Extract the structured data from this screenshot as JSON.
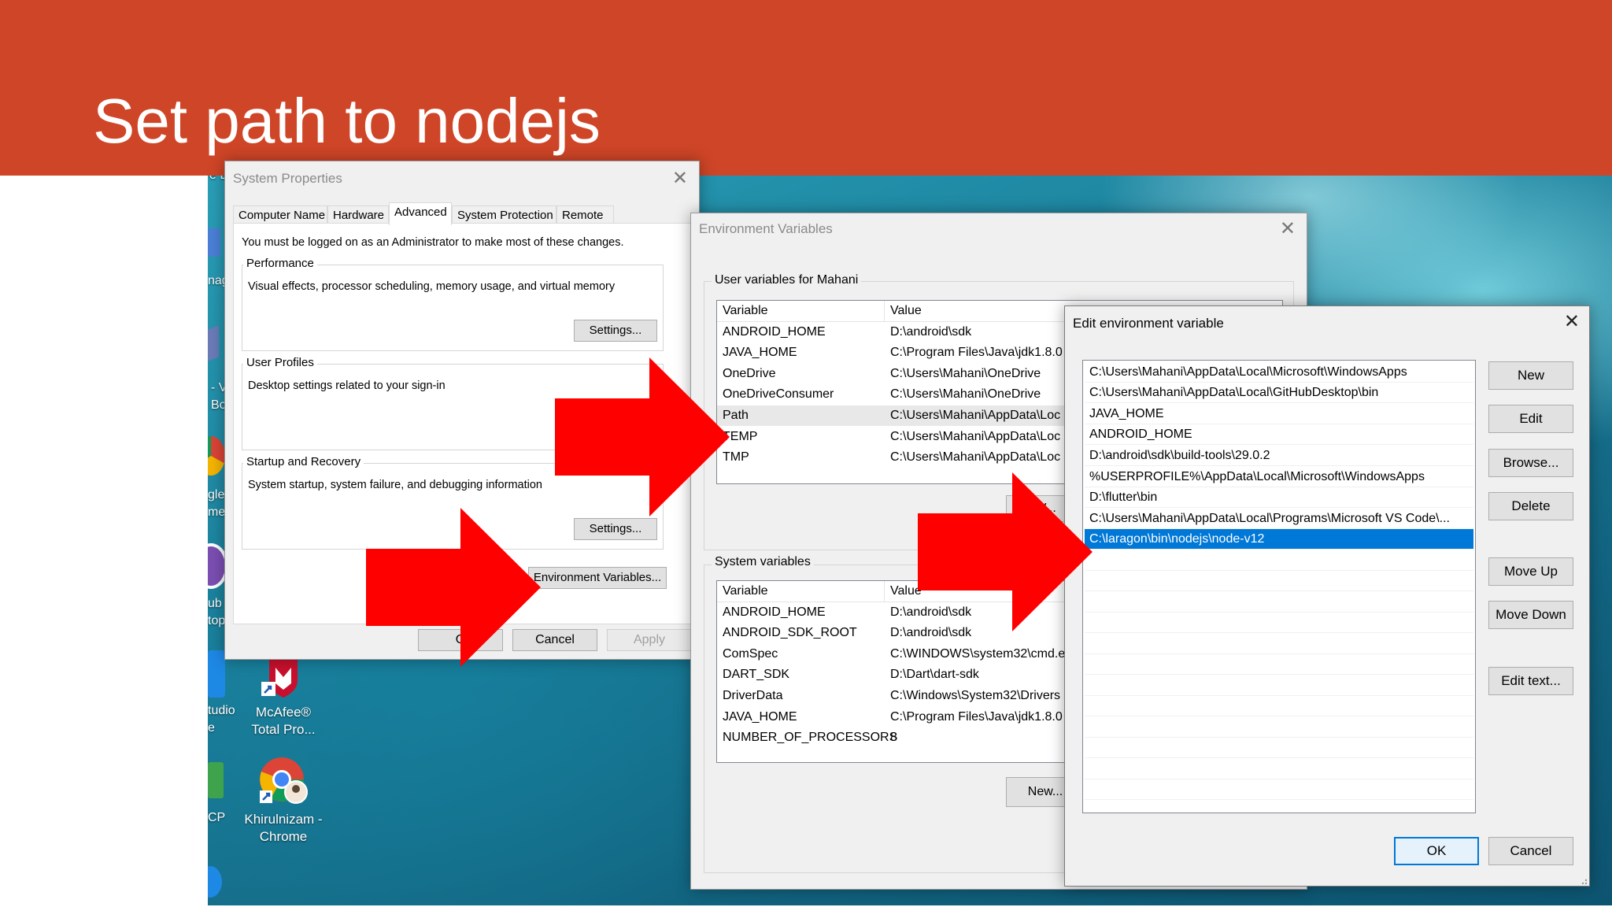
{
  "slide": {
    "title": "Set path to nodejs"
  },
  "desktop": {
    "icons": [
      {
        "label_line1": "McAfee®",
        "label_line2": "Total Pro...",
        "icon": "mcafee-shield-icon"
      },
      {
        "label_line1": "Khirulnizam -",
        "label_line2": "Chrome",
        "icon": "chrome-user-icon"
      }
    ],
    "edge_fragments": [
      "e B",
      "nag",
      "- VI",
      "Bo",
      "gle",
      "me",
      "ub",
      "top",
      "tudio",
      "e",
      "CP"
    ]
  },
  "system_properties": {
    "title": "System Properties",
    "tabs": [
      "Computer Name",
      "Hardware",
      "Advanced",
      "System Protection",
      "Remote"
    ],
    "active_tab": "Advanced",
    "admin_note": "You must be logged on as an Administrator to make most of these changes.",
    "performance": {
      "label": "Performance",
      "desc": "Visual effects, processor scheduling, memory usage, and virtual memory",
      "button": "Settings..."
    },
    "user_profiles": {
      "label": "User Profiles",
      "desc": "Desktop settings related to your sign-in"
    },
    "startup": {
      "label": "Startup and Recovery",
      "desc": "System startup, system failure, and debugging information",
      "button": "Settings..."
    },
    "env_button": "Environment Variables...",
    "ok": "O",
    "cancel": "Cancel",
    "apply": "Apply"
  },
  "env_vars": {
    "title": "Environment Variables",
    "user_label": "User variables for Mahani",
    "col_variable": "Variable",
    "col_value": "Value",
    "user_rows": [
      {
        "name": "ANDROID_HOME",
        "value": "D:\\android\\sdk"
      },
      {
        "name": "JAVA_HOME",
        "value": "C:\\Program Files\\Java\\jdk1.8.0"
      },
      {
        "name": "OneDrive",
        "value": "C:\\Users\\Mahani\\OneDrive"
      },
      {
        "name": "OneDriveConsumer",
        "value": "C:\\Users\\Mahani\\OneDrive"
      },
      {
        "name": "Path",
        "value": "C:\\Users\\Mahani\\AppData\\Loc"
      },
      {
        "name": "TEMP",
        "value": "C:\\Users\\Mahani\\AppData\\Loc"
      },
      {
        "name": "TMP",
        "value": "C:\\Users\\Mahani\\AppData\\Loc"
      }
    ],
    "user_new_button": "W...",
    "system_label": "System variables",
    "system_rows": [
      {
        "name": "ANDROID_HOME",
        "value": "D:\\android\\sdk"
      },
      {
        "name": "ANDROID_SDK_ROOT",
        "value": "D:\\android\\sdk"
      },
      {
        "name": "ComSpec",
        "value": "C:\\WINDOWS\\system32\\cmd.e"
      },
      {
        "name": "DART_SDK",
        "value": "D:\\Dart\\dart-sdk"
      },
      {
        "name": "DriverData",
        "value": "C:\\Windows\\System32\\Drivers"
      },
      {
        "name": "JAVA_HOME",
        "value": "C:\\Program Files\\Java\\jdk1.8.0"
      },
      {
        "name": "NUMBER_OF_PROCESSORS",
        "value": "8"
      }
    ],
    "system_new_button": "New..."
  },
  "edit_var": {
    "title": "Edit environment variable",
    "entries": [
      "C:\\Users\\Mahani\\AppData\\Local\\Microsoft\\WindowsApps",
      "C:\\Users\\Mahani\\AppData\\Local\\GitHubDesktop\\bin",
      "JAVA_HOME",
      "ANDROID_HOME",
      "D:\\android\\sdk\\build-tools\\29.0.2",
      "%USERPROFILE%\\AppData\\Local\\Microsoft\\WindowsApps",
      "D:\\flutter\\bin",
      "C:\\Users\\Mahani\\AppData\\Local\\Programs\\Microsoft VS Code\\...",
      "C:\\laragon\\bin\\nodejs\\node-v12"
    ],
    "selected_index": 8,
    "buttons": {
      "new": "New",
      "edit": "Edit",
      "browse": "Browse...",
      "delete": "Delete",
      "move_up": "Move Up",
      "move_down": "Move Down",
      "edit_text": "Edit text..."
    },
    "ok": "OK",
    "cancel": "Cancel"
  },
  "colors": {
    "banner": "#cf4527",
    "arrow": "#ff0000",
    "selection": "#0078d7"
  }
}
